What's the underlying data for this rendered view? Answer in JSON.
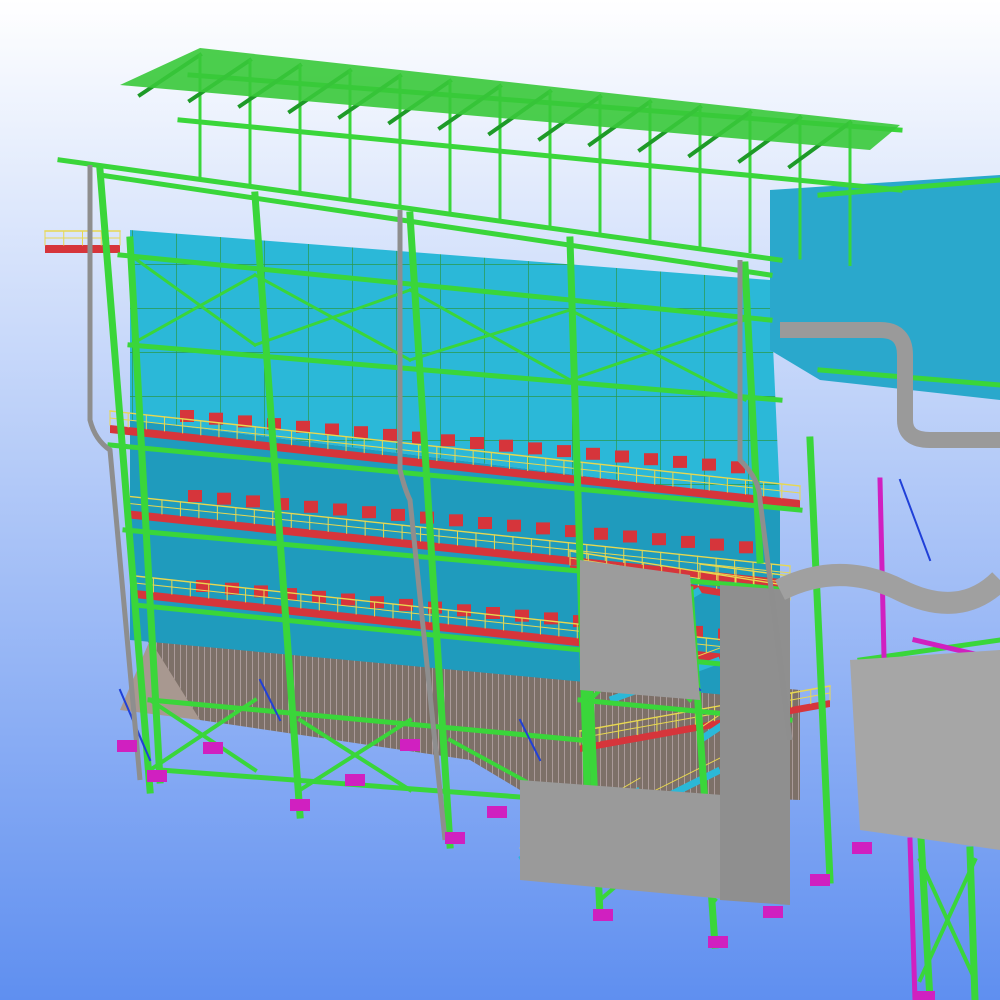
{
  "viewport": {
    "background": {
      "top": "#ffffff",
      "bottom": "#5f8ff0"
    }
  },
  "model": {
    "palette": {
      "steel": "#3ad63a",
      "steel_dark": "#1e9a28",
      "casing": "#2bb8d8",
      "casing_dark": "#1c8fb0",
      "platform": "#d6353b",
      "handrail": "#e8d850",
      "brace": "#2040d8",
      "pipe": "#9a9a9a",
      "panel": "#a8a8a8",
      "footing": "#d020c0",
      "hopper": "#8a7c72",
      "hopper_grating": "#d8c0c4"
    }
  }
}
